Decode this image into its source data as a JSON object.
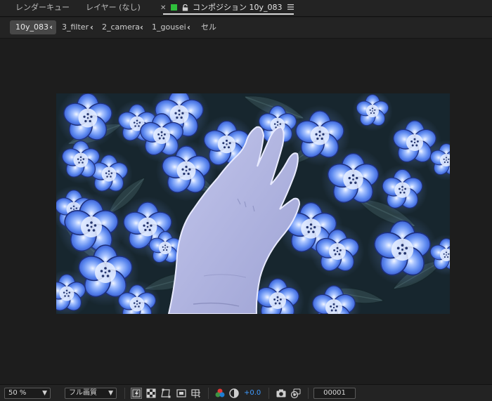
{
  "tabs": [
    {
      "label": "レンダーキュー"
    },
    {
      "label": "レイヤー (なし)"
    },
    {
      "label": "コンポジション 10y_083"
    }
  ],
  "breadcrumb": {
    "items": [
      "10y_083",
      "3_filter",
      "2_camera",
      "1_gousei",
      "セル"
    ]
  },
  "toolbar": {
    "zoom": "50 %",
    "resolution": "フル画質",
    "exposure": "+0.0",
    "frame": "00001"
  },
  "colors": {
    "comp_label": "#2fbf3b",
    "exposure_text": "#3f9bff",
    "flower_blue": "#5a86f0",
    "flower_glow": "#cfe4ff",
    "hand": "#b6b9e0"
  },
  "icons": [
    "close-icon",
    "color-label-swatch",
    "lock-icon",
    "panel-menu-icon",
    "chevron-left-icon",
    "chevron-down-icon",
    "fast-preview-icon",
    "transparency-grid-icon",
    "mask-path-icon",
    "region-of-interest-icon",
    "guides-icon",
    "channel-icon",
    "exposure-reset-icon",
    "snapshot-camera-icon",
    "show-snapshot-icon"
  ]
}
